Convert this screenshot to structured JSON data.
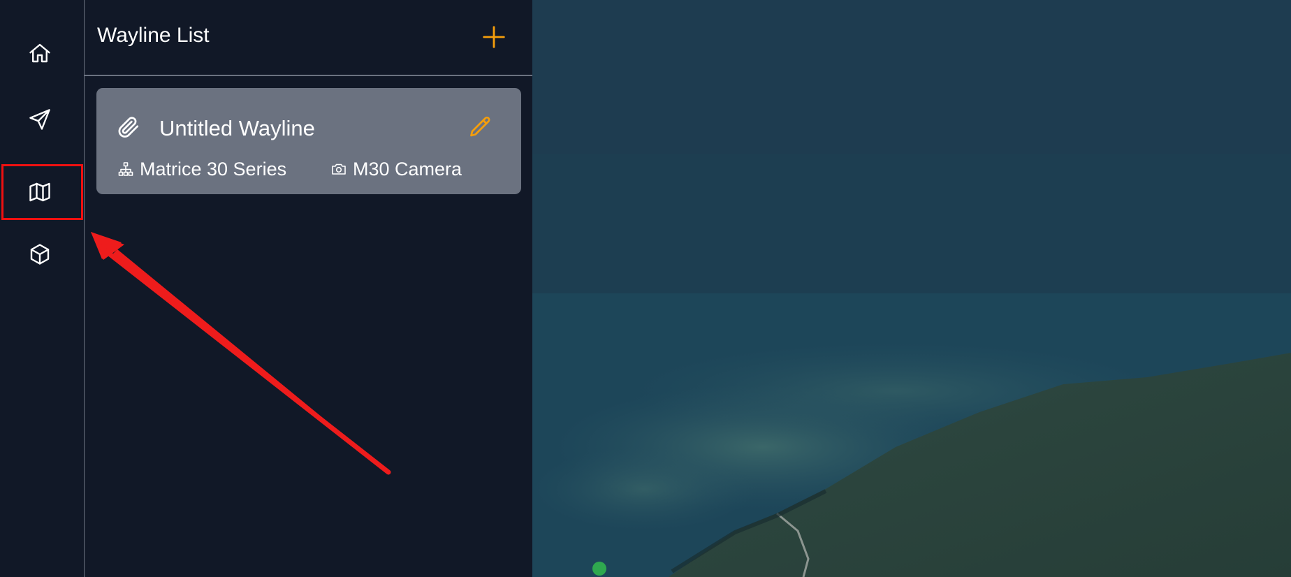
{
  "nav": {
    "items": [
      {
        "name": "home",
        "icon": "home-icon"
      },
      {
        "name": "send",
        "icon": "send-icon"
      },
      {
        "name": "wayline",
        "icon": "map-icon",
        "highlighted": true
      },
      {
        "name": "model",
        "icon": "cube-icon"
      }
    ]
  },
  "panel": {
    "title": "Wayline List",
    "add_icon": "plus-icon"
  },
  "wayline": {
    "name": "Untitled Wayline",
    "drone": "Matrice 30 Series",
    "camera": "M30 Camera"
  },
  "colors": {
    "background": "#111827",
    "card": "#6b7280",
    "accent": "#f59e0b",
    "highlight": "#ef1010",
    "text": "#ffffff"
  }
}
